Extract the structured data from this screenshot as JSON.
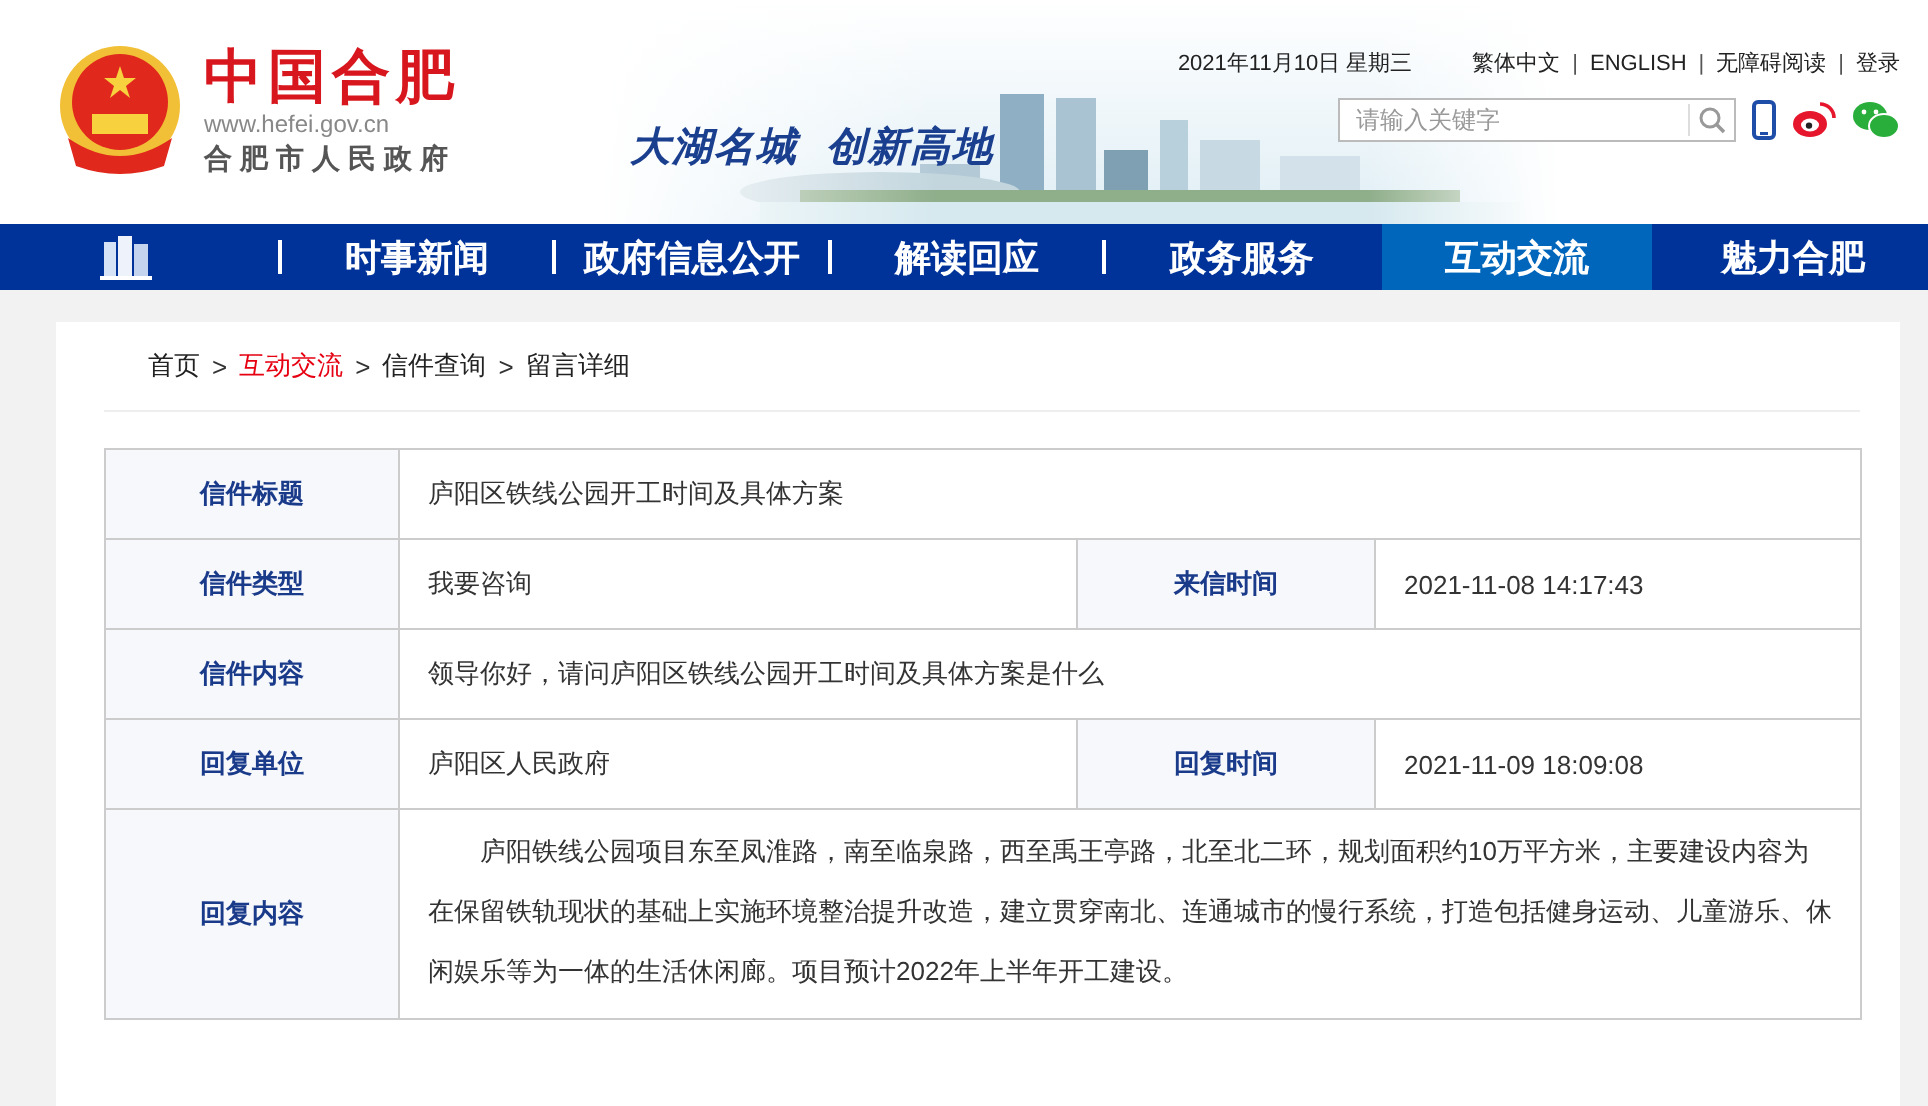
{
  "header": {
    "logo_title": "中国合肥",
    "logo_url": "www.hefei.gov.cn",
    "logo_subtitle": "合肥市人民政府",
    "slogan": [
      "大湖名城",
      "创新高地"
    ],
    "date": "2021年11月10日 星期三",
    "link_separator": "|",
    "links": [
      "繁体中文",
      "ENGLISH",
      "无障碍阅读",
      "登录"
    ],
    "search": {
      "placeholder": "请输入关键字"
    }
  },
  "nav": [
    {
      "label": "时事新闻",
      "selected": false
    },
    {
      "label": "政府信息公开",
      "selected": false
    },
    {
      "label": "解读回应",
      "selected": false
    },
    {
      "label": "政务服务",
      "selected": false
    },
    {
      "label": "互动交流",
      "selected": true
    },
    {
      "label": "魅力合肥",
      "selected": false
    }
  ],
  "breadcrumb": {
    "separator": ">",
    "items": [
      {
        "label": "首页",
        "highlighted": false
      },
      {
        "label": "互动交流",
        "highlighted": true
      },
      {
        "label": "信件查询",
        "highlighted": false
      },
      {
        "label": "留言详细",
        "highlighted": false
      }
    ]
  },
  "table": {
    "rows": [
      {
        "cells": [
          {
            "label": "信件标题",
            "value": "庐阳区铁线公园开工时间及具体方案"
          }
        ]
      },
      {
        "cells": [
          {
            "label": "信件类型",
            "value": "我要咨询"
          },
          {
            "label": "来信时间",
            "value": "2021-11-08 14:17:43"
          }
        ]
      },
      {
        "cells": [
          {
            "label": "信件内容",
            "value": "领导你好，请问庐阳区铁线公园开工时间及具体方案是什么"
          }
        ]
      },
      {
        "cells": [
          {
            "label": "回复单位",
            "value": "庐阳区人民政府"
          },
          {
            "label": "回复时间",
            "value": "2021-11-09 18:09:08"
          }
        ]
      },
      {
        "cells": [
          {
            "label": "回复内容",
            "value": "庐阳铁线公园项目东至凤淮路，南至临泉路，西至禹王亭路，北至北二环，规划面积约10万平方米，主要建设内容为在保留铁轨现状的基础上实施环境整治提升改造，建立贯穿南北、连通城市的慢行系统，打造包括健身运动、儿童游乐、休闲娱乐等为一体的生活休闲廊。项目预计2022年上半年开工建设。",
            "kind": "paragraph"
          }
        ]
      }
    ]
  }
}
